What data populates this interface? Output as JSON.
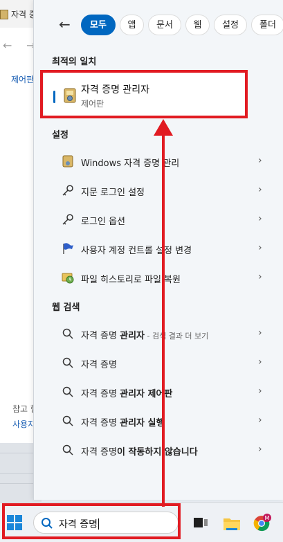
{
  "background_window": {
    "title": "자격 증",
    "nav_back": "←",
    "nav_forward": "→",
    "link": "제어판",
    "ref_label": "참고 항",
    "ref_link": "사용자"
  },
  "search_panel": {
    "back_label": "←",
    "filters": [
      "모두",
      "앱",
      "문서",
      "웹",
      "설정",
      "폴더"
    ],
    "best_match": {
      "heading": "최적의 일치",
      "title": "자격 증명 관리자",
      "subtitle": "제어판"
    },
    "settings": {
      "heading": "설정",
      "items": [
        {
          "label": "Windows 자격 증명 관리",
          "icon": "credential-manager-icon"
        },
        {
          "label": "지문 로그인 설정",
          "icon": "key-icon"
        },
        {
          "label": "로그인 옵션",
          "icon": "key-icon"
        },
        {
          "label": "사용자 계정 컨트롤 설정 변경",
          "icon": "uac-flag-icon"
        },
        {
          "label": "파일 히스토리로 파일 복원",
          "icon": "file-history-icon"
        }
      ]
    },
    "web": {
      "heading": "웹 검색",
      "items": [
        {
          "normal": "자격 증명 ",
          "bold": "관리자",
          "suffix": " - 검색 결과 더 보기"
        },
        {
          "normal": "자격 증명",
          "bold": "",
          "suffix": ""
        },
        {
          "normal": "자격 증명 ",
          "bold": "관리자 제어판",
          "suffix": ""
        },
        {
          "normal": "자격 증명 ",
          "bold": "관리자 실행",
          "suffix": ""
        },
        {
          "normal": "자격 증명",
          "bold": "이 작동하지 않습니다",
          "suffix": ""
        }
      ]
    },
    "chevron": "›"
  },
  "taskbar": {
    "search_query": "자격 증명",
    "chrome_badge": "M"
  },
  "colors": {
    "accent": "#0067c0",
    "highlight": "#e11b22"
  }
}
